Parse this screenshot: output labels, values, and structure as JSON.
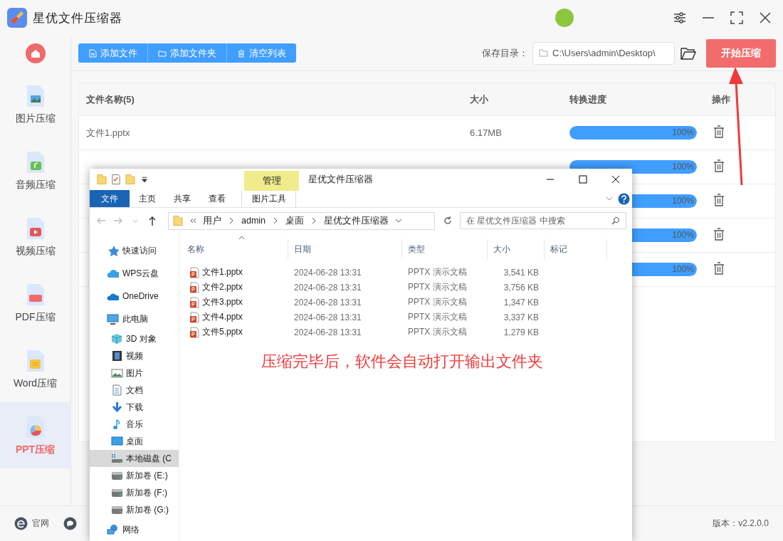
{
  "app": {
    "title": "星优文件压缩器"
  },
  "sidebar": {
    "items": [
      {
        "kind": "home",
        "selected": false
      },
      {
        "kind": "image",
        "label": "图片压缩",
        "selected": false
      },
      {
        "kind": "audio",
        "label": "音频压缩",
        "selected": false
      },
      {
        "kind": "video",
        "label": "视频压缩",
        "selected": false
      },
      {
        "kind": "pdf",
        "label": "PDF压缩",
        "selected": false
      },
      {
        "kind": "word",
        "label": "Word压缩",
        "selected": false
      },
      {
        "kind": "ppt",
        "label": "PPT压缩",
        "selected": true
      }
    ]
  },
  "toolbar": {
    "buttons": [
      {
        "kind": "file",
        "label": "添加文件"
      },
      {
        "kind": "folder",
        "label": "添加文件夹"
      },
      {
        "kind": "trash",
        "label": "清空列表"
      }
    ],
    "save_dir_label": "保存目录：",
    "save_dir": "C:\\Users\\admin\\Desktop\\",
    "start_button": "开始压缩"
  },
  "table": {
    "columns": [
      "文件名称(5)",
      "大小",
      "转换进度",
      "操作"
    ],
    "rows": [
      {
        "name": "文件1.pptx",
        "size": "6.17MB",
        "level": 1,
        "reading": "100%"
      },
      {
        "level": 1,
        "reading": "100%"
      },
      {
        "level": 1,
        "reading": "100%"
      },
      {
        "level": 1,
        "reading": "100%"
      },
      {
        "level": 1,
        "reading": "100%"
      }
    ]
  },
  "footer": {
    "links": [
      {
        "kind": "web",
        "label": "官网"
      },
      {
        "kind": "chat"
      }
    ],
    "version": "版本：v2.2.0.0"
  },
  "explorer": {
    "context_tab": "管理",
    "title": "星优文件压缩器",
    "tabs": [
      {
        "label": "文件",
        "selected": true
      },
      {
        "label": "主页",
        "selected": false
      },
      {
        "label": "共享",
        "selected": false
      },
      {
        "label": "查看",
        "selected": false
      },
      {
        "label": "图片工具",
        "selected": false
      }
    ],
    "breadcrumb": [
      "用户",
      "admin",
      "桌面",
      "星优文件压缩器"
    ],
    "search": {
      "placeholder": "在 星优文件压缩器 中搜索"
    },
    "nav": [
      {
        "kind": "star",
        "label": "快速访问",
        "selected": false
      },
      {
        "kind": "cloud",
        "label": "WPS云盘",
        "selected": false
      },
      {
        "kind": "onedrive",
        "label": "OneDrive",
        "selected": false
      },
      {
        "kind": "pc",
        "label": "此电脑",
        "selected": false,
        "children": [
          {
            "kind": "cube",
            "label": "3D 对象",
            "selected": false
          },
          {
            "kind": "film",
            "label": "视频",
            "selected": false
          },
          {
            "kind": "photo",
            "label": "图片",
            "selected": false
          },
          {
            "kind": "doc",
            "label": "文档",
            "selected": false
          },
          {
            "kind": "download",
            "label": "下载",
            "selected": false
          },
          {
            "kind": "music",
            "label": "音乐",
            "selected": false
          },
          {
            "kind": "desktop",
            "label": "桌面",
            "selected": false
          },
          {
            "kind": "sysdrive",
            "label": "本地磁盘 (C",
            "selected": true
          },
          {
            "kind": "drive",
            "label": "新加卷 (E:)",
            "selected": false
          },
          {
            "kind": "drive",
            "label": "新加卷 (F:)",
            "selected": false
          },
          {
            "kind": "drive",
            "label": "新加卷 (G:)",
            "selected": false
          }
        ]
      },
      {
        "kind": "network",
        "label": "网络",
        "selected": false
      }
    ],
    "columns": [
      "名称",
      "日期",
      "类型",
      "大小",
      "标记"
    ],
    "files": [
      {
        "name": "文件1.pptx",
        "date": "2024-06-28 13:31",
        "type": "PPTX 演示文稿",
        "size": "3,541 KB"
      },
      {
        "name": "文件2.pptx",
        "date": "2024-06-28 13:31",
        "type": "PPTX 演示文稿",
        "size": "3,756 KB"
      },
      {
        "name": "文件3.pptx",
        "date": "2024-06-28 13:31",
        "type": "PPTX 演示文稿",
        "size": "1,347 KB"
      },
      {
        "name": "文件4.pptx",
        "date": "2024-06-28 13:31",
        "type": "PPTX 演示文稿",
        "size": "3,337 KB"
      },
      {
        "name": "文件5.pptx",
        "date": "2024-06-28 13:31",
        "type": "PPTX 演示文稿",
        "size": "1,279 KB"
      }
    ]
  },
  "annotation": {
    "text": "压缩完毕后，软件会自动打开输出文件夹"
  }
}
